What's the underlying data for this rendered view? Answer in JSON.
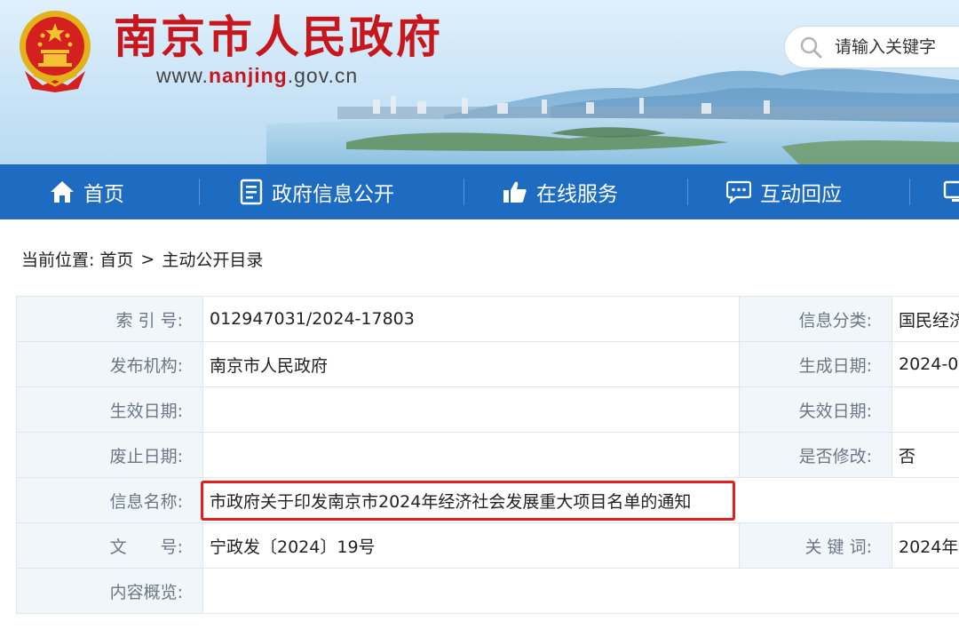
{
  "header": {
    "site_title": "南京市人民政府",
    "url_prefix": "www.",
    "url_brand": "nanjing",
    "url_suffix": ".gov.cn",
    "search_placeholder": "请输入关键字",
    "brand_color": "#c8161d"
  },
  "nav": {
    "color": "#1d6cc2",
    "items": [
      {
        "label": "首页",
        "icon": "home-icon"
      },
      {
        "label": "政府信息公开",
        "icon": "document-icon"
      },
      {
        "label": "在线服务",
        "icon": "thumbs-up-icon"
      },
      {
        "label": "互动回应",
        "icon": "chat-icon"
      },
      {
        "label": "",
        "icon": "monitor-icon"
      }
    ]
  },
  "breadcrumb": {
    "prefix": "当前位置:",
    "items": [
      "首页",
      "主动公开目录"
    ],
    "separator": ">"
  },
  "info": {
    "rows": [
      {
        "label": "索 引 号:",
        "value": "012947031/2024-17803",
        "label2": "信息分类:",
        "value2": "国民经济"
      },
      {
        "label": "发布机构:",
        "value": "南京市人民政府",
        "label2": "生成日期:",
        "value2": "2024-0"
      },
      {
        "label": "生效日期:",
        "value": "",
        "label2": "失效日期:",
        "value2": ""
      },
      {
        "label": "废止日期:",
        "value": "",
        "label2": "是否修改:",
        "value2": "否"
      },
      {
        "label": "信息名称:",
        "value": "市政府关于印发南京市2024年经济社会发展重大项目名单的通知"
      },
      {
        "label": "文　　号:",
        "value": "宁政发〔2024〕19号",
        "label2": "关 键 词:",
        "value2": "2024年"
      },
      {
        "label": "内容概览:",
        "value": ""
      }
    ],
    "highlight_color": "#e0201f"
  }
}
